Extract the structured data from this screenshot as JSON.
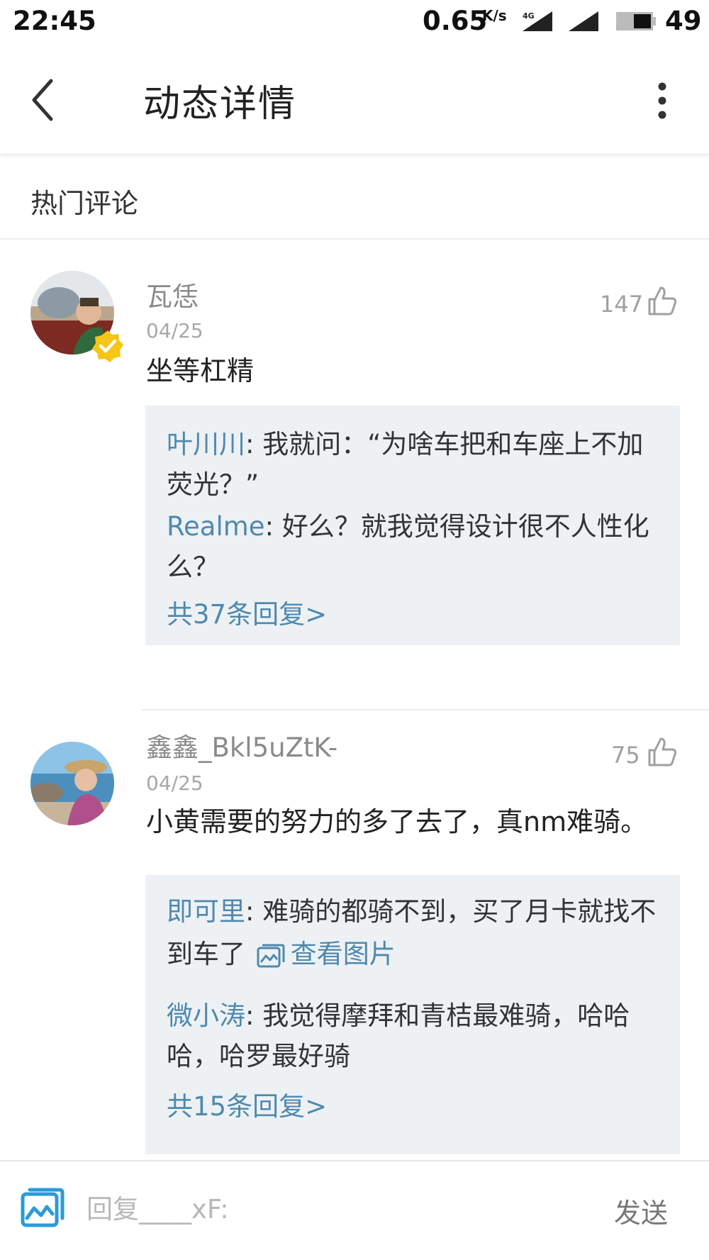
{
  "status_bar": {
    "time": "22:45",
    "net_speed": "0.65",
    "net_speed_unit": "K/s",
    "network_type": "4G",
    "battery": "49"
  },
  "header": {
    "title": "动态详情"
  },
  "section": {
    "title": "热门评论"
  },
  "comments": [
    {
      "author": "瓦恁",
      "date": "04/25",
      "likes": "147",
      "content": "坐等杠精",
      "verified": true,
      "replies": [
        {
          "name": "叶川川",
          "sep": ": ",
          "text": "我就问：“为啥车把和车座上不加荧光？”"
        },
        {
          "name": "Realme",
          "sep": ": ",
          "text": "好么？就我觉得设计很不人性化么？"
        }
      ],
      "more": "共37条回复>"
    },
    {
      "author": "鑫鑫_Bkl5uZtK-",
      "date": "04/25",
      "likes": "75",
      "content": "小黄需要的努力的多了去了，真nm难骑。",
      "verified": false,
      "replies": [
        {
          "name": "即可里",
          "sep": ": ",
          "text": "难骑的都骑不到，买了月卡就找不到车了",
          "link": "查看图片"
        },
        {
          "name": "微小涛",
          "sep": ": ",
          "text": "我觉得摩拜和青桔最难骑，哈哈哈，哈罗最好骑"
        }
      ],
      "more": "共15条回复>"
    }
  ],
  "bottom_bar": {
    "placeholder": "回复____xF:",
    "send_label": "发送"
  },
  "colors": {
    "accent": "#4f89ae",
    "reply_bg": "#eef1f4",
    "verified_badge": "#f5c518"
  }
}
